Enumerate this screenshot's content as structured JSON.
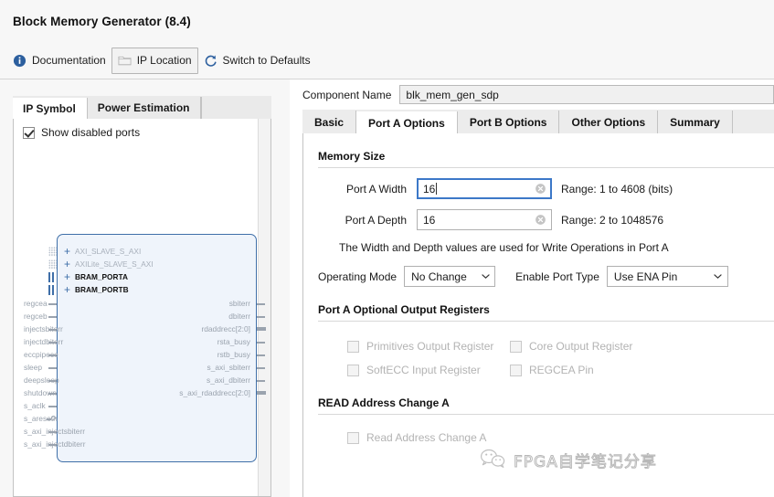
{
  "window": {
    "title": "Block Memory Generator (8.4)"
  },
  "toolbar": {
    "documentation": "Documentation",
    "ip_location": "IP Location",
    "switch_defaults": "Switch to Defaults"
  },
  "left_panel": {
    "tabs": [
      {
        "label": "IP Symbol",
        "active": true
      },
      {
        "label": "Power Estimation",
        "active": false
      }
    ],
    "show_disabled_ports": {
      "label": "Show disabled ports",
      "checked": true
    },
    "symbol": {
      "buses": [
        {
          "label": "AXI_SLAVE_S_AXI",
          "enabled": false
        },
        {
          "label": "AXILite_SLAVE_S_AXI",
          "enabled": false
        },
        {
          "label": "BRAM_PORTA",
          "enabled": true
        },
        {
          "label": "BRAM_PORTB",
          "enabled": true
        }
      ],
      "inputs": [
        {
          "label": "regcea",
          "type": "pin"
        },
        {
          "label": "regceb",
          "type": "pin"
        },
        {
          "label": "injectsbiterr",
          "type": "pin"
        },
        {
          "label": "injectdbiterr",
          "type": "pin"
        },
        {
          "label": "eccpipece",
          "type": "pin"
        },
        {
          "label": "sleep",
          "type": "pin"
        },
        {
          "label": "deepsleep",
          "type": "pin"
        },
        {
          "label": "shutdown",
          "type": "pin"
        },
        {
          "label": "s_aclk",
          "type": "pin"
        },
        {
          "label": "s_aresetn",
          "type": "pin-inverted"
        },
        {
          "label": "s_axi_injectsbiterr",
          "type": "pin"
        },
        {
          "label": "s_axi_injectdbiterr",
          "type": "pin"
        }
      ],
      "outputs": [
        {
          "label": "sbiterr",
          "type": "pin"
        },
        {
          "label": "dbiterr",
          "type": "pin"
        },
        {
          "label": "rdaddrecc[2:0]",
          "type": "bus"
        },
        {
          "label": "rsta_busy",
          "type": "pin"
        },
        {
          "label": "rstb_busy",
          "type": "pin"
        },
        {
          "label": "s_axi_sbiterr",
          "type": "pin"
        },
        {
          "label": "s_axi_dbiterr",
          "type": "pin"
        },
        {
          "label": "s_axi_rdaddrecc[2:0]",
          "type": "bus"
        }
      ]
    }
  },
  "right_panel": {
    "component_name": {
      "label": "Component Name",
      "value": "blk_mem_gen_sdp"
    },
    "tabs": [
      {
        "label": "Basic",
        "active": false
      },
      {
        "label": "Port A Options",
        "active": true
      },
      {
        "label": "Port B Options",
        "active": false
      },
      {
        "label": "Other Options",
        "active": false
      },
      {
        "label": "Summary",
        "active": false
      }
    ],
    "memory_size": {
      "title": "Memory Size",
      "port_a_width": {
        "label": "Port A Width",
        "value": "16",
        "range": "Range: 1 to 4608 (bits)",
        "focused": true
      },
      "port_a_depth": {
        "label": "Port A Depth",
        "value": "16",
        "range": "Range: 2 to 1048576",
        "focused": false
      },
      "hint": "The Width and Depth values are used for Write Operations in Port A"
    },
    "operating_mode": {
      "label": "Operating Mode",
      "value": "No Change"
    },
    "enable_port_type": {
      "label": "Enable Port Type",
      "value": "Use ENA Pin"
    },
    "optional_registers": {
      "title": "Port A Optional Output Registers",
      "items": [
        {
          "label": "Primitives Output Register",
          "checked": false,
          "disabled": true
        },
        {
          "label": "Core Output Register",
          "checked": false,
          "disabled": true
        },
        {
          "label": "SoftECC Input Register",
          "checked": false,
          "disabled": true
        },
        {
          "label": "REGCEA Pin",
          "checked": false,
          "disabled": true
        }
      ]
    },
    "read_address_change": {
      "title": "READ Address Change A",
      "item": {
        "label": "Read Address Change A",
        "checked": false,
        "disabled": true
      }
    }
  },
  "watermark": {
    "text": "FPGA自学笔记分享"
  },
  "colors": {
    "accent_blue": "#3f6fa8",
    "focus_blue": "#3c78c8",
    "panel_bg": "#f7f7f7",
    "symbol_fill": "#eff4fb",
    "disabled_text": "#b3b3b3"
  }
}
